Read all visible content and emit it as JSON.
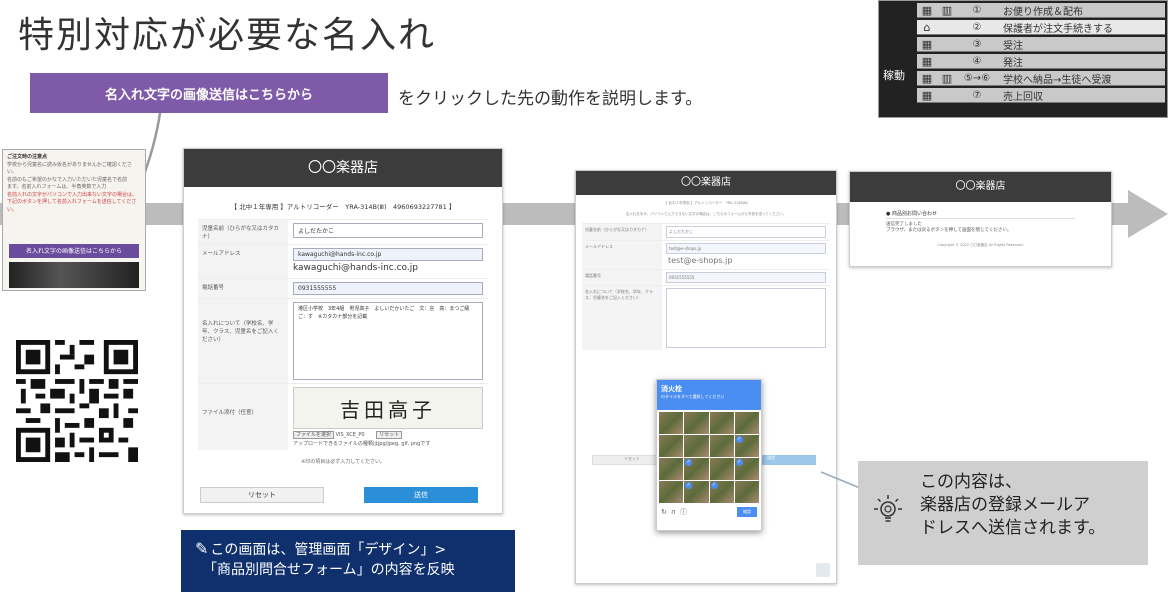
{
  "page_title": "特別対応が必要な名入れ",
  "cta": {
    "button_label": "名入れ文字の画像送信はこちらから",
    "description": "をクリックした先の動作を説明します。"
  },
  "legend": {
    "side_label": "稼動",
    "rows": [
      {
        "num": "①",
        "text": "お便り作成＆配布"
      },
      {
        "num": "②",
        "text": "保護者が注文手続きする"
      },
      {
        "num": "③",
        "text": "受注"
      },
      {
        "num": "④",
        "text": "発注"
      },
      {
        "num": "⑤→⑥",
        "text": "学校へ納品→生徒へ受渡"
      },
      {
        "num": "⑦",
        "text": "売上回収"
      }
    ]
  },
  "thumb": {
    "title": "ご注文時の注意点",
    "line1": "学校から児童名に読み仮名がありませんかご確認ください。",
    "line2": "名前のもご希望のかなで入力いただいた児童名で名前",
    "line3": "ます。名前入れフォームは、半角英数で入力",
    "warn": "名前入れの文字がパソコンで入力出来ない文字の場合は、下記のボタンを押して名前入れフォームを送信してください。",
    "button": "名入れ文字の画像送信はこちらから"
  },
  "form1": {
    "shop_name": "〇〇楽器店",
    "product": "【 北中１年専用 】アルトリコーダー　YRA-314B(Ⅲ)　4960693227781 】",
    "rows": [
      {
        "label": "児童名前（ひらがな又はカタカナ）",
        "value": "よしだたかこ"
      },
      {
        "label": "メールアドレス",
        "value": "kawaguchi@hands-inc.co.jp",
        "large": "kawaguchi@hands-inc.co.jp"
      },
      {
        "label": "電話番号",
        "value": "0931555555"
      }
    ],
    "detail_label": "名入れについて（学校名、学年、クラス、児童名をご記入ください）",
    "detail_text": "港区小学校　3年4組　男児高子　よしいだかいたご　文：言　高：まつご級　ご：す　※カタカナ部分を記載",
    "file_label": "ファイル添付（任意）",
    "signature": "吉田高子",
    "file_button": "ファイルを選択",
    "file_name": "VIS_XCE_P0",
    "clear_button": "リセット",
    "file_hint": "アップロードできるファイルの種類はjpg/jpeg, gif, pngです",
    "required_note": "※印の項目は必ず入力してください。",
    "reset": "リセット",
    "send": "送信"
  },
  "info_box": {
    "line1": "この画面は、管理画面「デザイン」>",
    "line2": "「商品別問合せフォーム」の内容を反映"
  },
  "form2": {
    "shop_name": "〇〇楽器店",
    "product": "【 北中１年専用 】アルトリコーダー　YRA-314B(Ⅲ)",
    "intro": "名入れ文字が、パソコンで入力できない文字の場合は、こちらのフォームから写真を送ってください。",
    "rows": [
      {
        "label": "児童名前（ひらがな又はカタカナ）",
        "value": "よしだたかこ"
      },
      {
        "label": "メールアドレス",
        "value": "test@e-shops.jp",
        "large": "test@e-shops.jp"
      },
      {
        "label": "電話番号",
        "value": "0931555555"
      }
    ],
    "reset": "リセット",
    "send": "送信"
  },
  "captcha": {
    "title": "消火栓",
    "subtitle": "のタイルをすべて選択してください",
    "refresh_icon": "↻",
    "audio_icon": "∩",
    "info_icon": "ⓘ",
    "verify": "確認"
  },
  "form3": {
    "shop_name": "〇〇楽器店",
    "heading": "商品別お問い合わせ",
    "message": "送信完了しました\nブラウザ、または戻るボタンを押して画面を閉じてください。",
    "copyright": "Copyright © 2022 〇〇楽器店 All Rights Reserved."
  },
  "callout": {
    "line1": "この内容は、",
    "line2": "楽器店の登録メールア",
    "line3": "ドレスへ送信されます。"
  }
}
